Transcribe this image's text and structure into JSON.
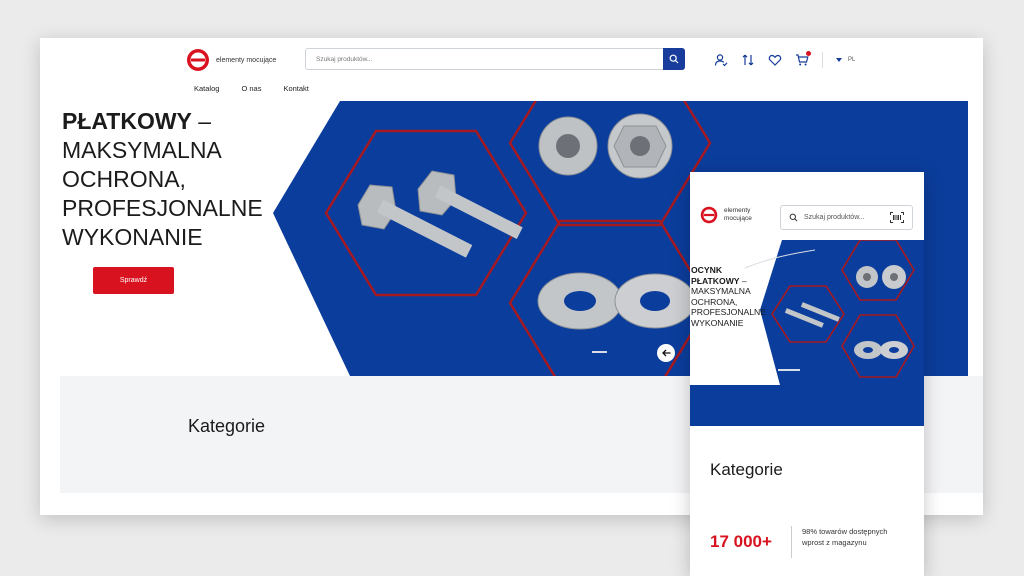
{
  "header": {
    "logo_text": "elementy mocujące",
    "search_placeholder": "Szukaj produktów...",
    "lang": "PL",
    "nav": [
      "Katalog",
      "O nas",
      "Kontakt"
    ]
  },
  "hero": {
    "title_bold": "PŁATKOWY",
    "title_rest_lines": [
      "MAKSYMALNA",
      "OCHRONA,",
      "PROFESJONALNE",
      "WYKONANIE"
    ],
    "cta": "Sprawdź"
  },
  "categories": {
    "title": "Kategorie"
  },
  "mobile": {
    "logo_text": "elementy mocujące",
    "search_placeholder": "Szukaj produktów...",
    "hero_bold_lines": [
      "OCYNK",
      "PŁATKOWY"
    ],
    "hero_rest_lines": [
      "MAKSYMALNA",
      "OCHRONA,",
      "PROFESJONALNE",
      "WYKONANIE"
    ],
    "categories_title": "Kategorie",
    "stat_number": "17 000+",
    "stat_text": "98% towarów dostępnych wprost z magazynu"
  },
  "colors": {
    "brand_blue": "#0b3d9c",
    "brand_red": "#d9121f",
    "hex_outline": "#a8191f"
  }
}
